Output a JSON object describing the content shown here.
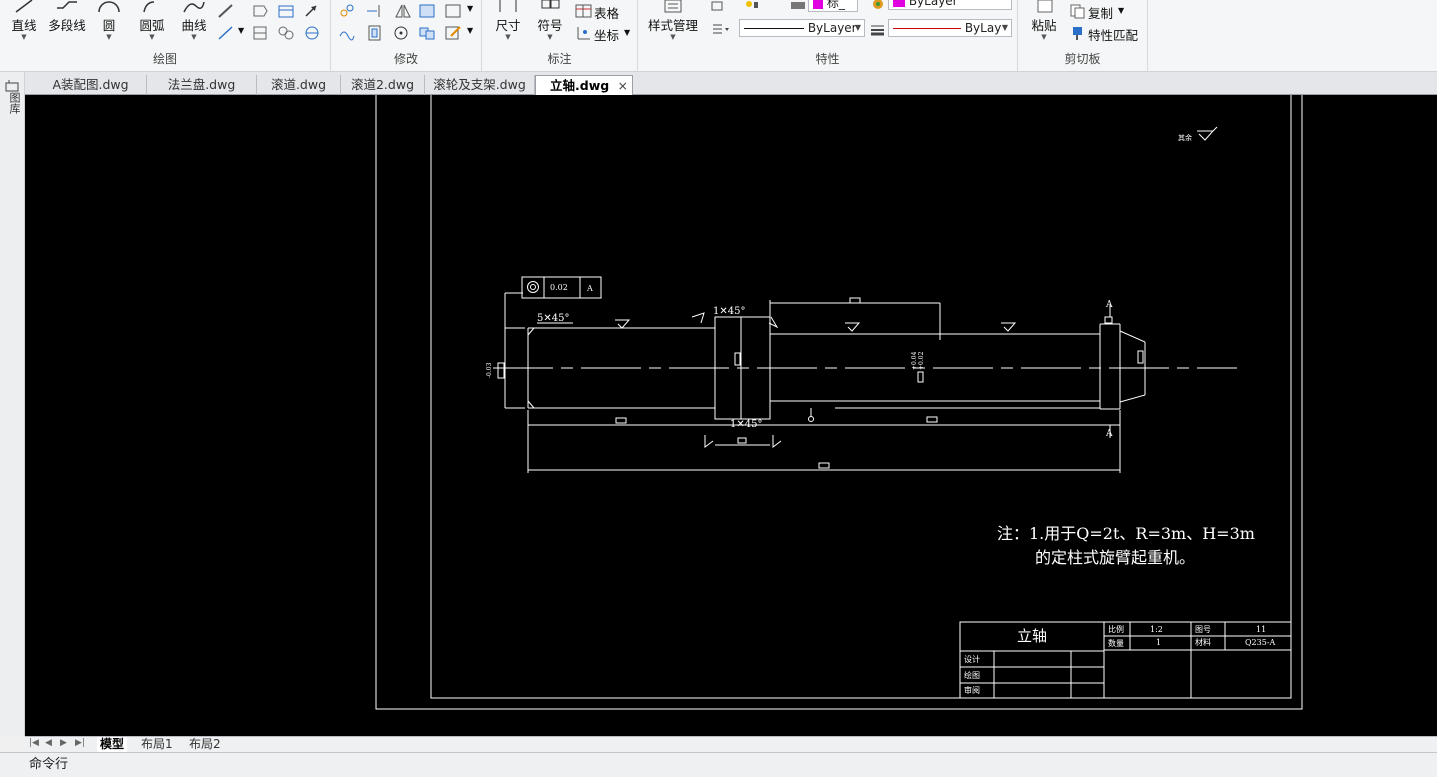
{
  "ribbon": {
    "draw_group": {
      "label": "绘图",
      "line": "直线",
      "polyline": "多段线",
      "circle": "圆",
      "arc": "圆弧",
      "curve": "曲线"
    },
    "modify_group": {
      "label": "修改"
    },
    "annotate_group": {
      "label": "标注",
      "dimension": "尺寸",
      "symbol": "符号",
      "table": "表格",
      "coordinate": "坐标"
    },
    "properties_group": {
      "label": "特性",
      "style_manager": "样式管理",
      "layer_value": "标_",
      "color_value": "ByLayer",
      "linetype_value": "ByLayer",
      "lineweight_value": "ByLay",
      "accent_magenta": "#e000e0",
      "accent_red": "#cc0000"
    },
    "clipboard_group": {
      "label": "剪切板",
      "paste": "粘贴",
      "copy": "复制",
      "match_props": "特性匹配"
    }
  },
  "left_strip": {
    "label": "图库"
  },
  "file_tabs": [
    {
      "label": "A装配图.dwg",
      "active": false
    },
    {
      "label": "法兰盘.dwg",
      "active": false
    },
    {
      "label": "滚道.dwg",
      "active": false
    },
    {
      "label": "滚道2.dwg",
      "active": false
    },
    {
      "label": "滚轮及支架.dwg",
      "active": false
    },
    {
      "label": "立轴.dwg",
      "active": true
    }
  ],
  "tab_close_glyph": "×",
  "drawing": {
    "roughness_other": "其余",
    "tolerance_value": "0.02",
    "datum": "A",
    "chamfer_left": "5✕45°",
    "chamfer_collar_top": "1✕45°",
    "chamfer_collar_bottom": "1✕45°",
    "tol_left": "-0.03",
    "tol_mid": "+0.04",
    "tol_mid2": "+0.02",
    "section_a_top": "A",
    "section_a_bottom": "A",
    "note_line1": "注：1.用于Q=2t、R=3m、H=3m",
    "note_line2": "的定柱式旋臂起重机。",
    "title_block": {
      "part_name": "立轴",
      "scale_label": "比例",
      "scale_value": "1:2",
      "drawing_no_label": "图号",
      "drawing_no_value": "11",
      "quantity_label": "数量",
      "quantity_value": "1",
      "material_label": "材料",
      "material_value": "Q235-A",
      "design_label": "设计",
      "draw_label": "绘图",
      "review_label": "审阅"
    }
  },
  "layout_tabs": [
    {
      "label": "模型",
      "active": true
    },
    {
      "label": "布局1",
      "active": false
    },
    {
      "label": "布局2",
      "active": false
    }
  ],
  "command_line": {
    "label": "命令行"
  }
}
